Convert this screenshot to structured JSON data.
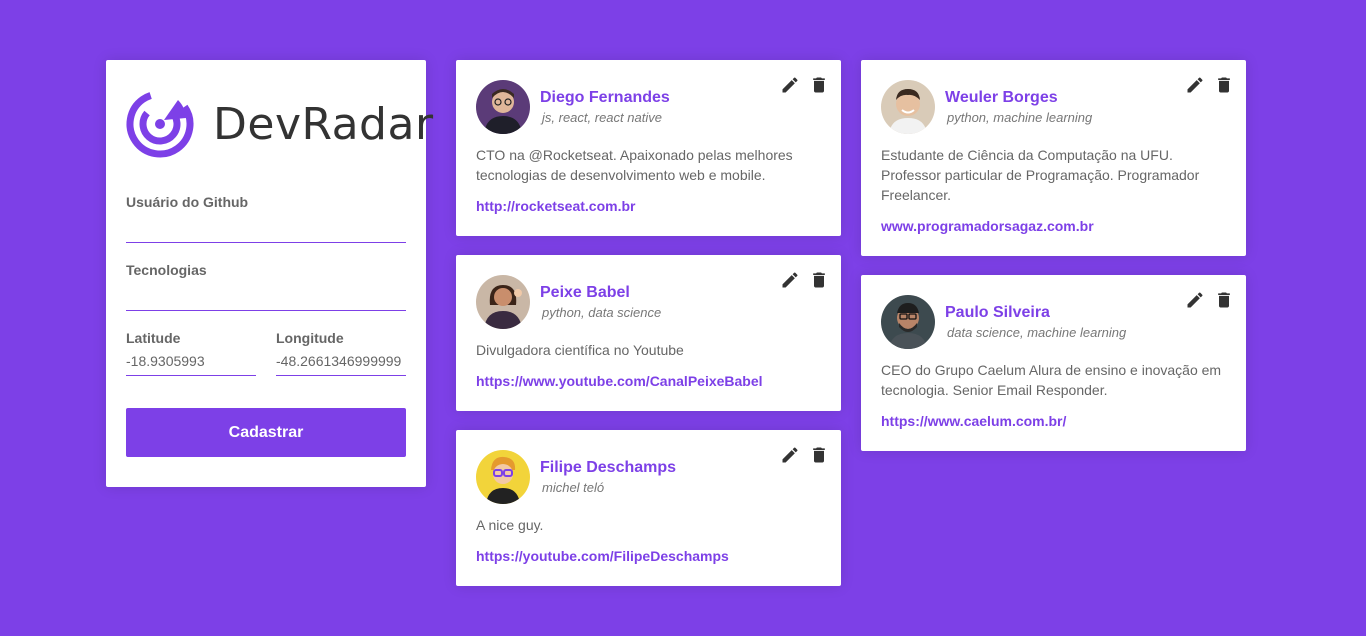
{
  "brand": {
    "name": "DevRadar",
    "color": "#7d40e7"
  },
  "form": {
    "github_label": "Usuário do Github",
    "github_value": "",
    "techs_label": "Tecnologias",
    "techs_value": "",
    "latitude_label": "Latitude",
    "latitude_value": "-18.9305993",
    "longitude_label": "Longitude",
    "longitude_value": "-48.2661346999999",
    "submit_label": "Cadastrar"
  },
  "devs": [
    {
      "name": "Diego Fernandes",
      "techs": "js, react, react native",
      "bio": "CTO na @Rocketseat. Apaixonado pelas melhores tecnologias de desenvolvimento web e mobile.",
      "link": "http://rocketseat.com.br",
      "avatar_bg": "#5b3b78"
    },
    {
      "name": "Peixe Babel",
      "techs": "python, data science",
      "bio": "Divulgadora científica no Youtube",
      "link": "https://www.youtube.com/CanalPeixeBabel",
      "avatar_bg": "#c9b7a6"
    },
    {
      "name": "Filipe Deschamps",
      "techs": "michel teló",
      "bio": "A nice guy.",
      "link": "https://youtube.com/FilipeDeschamps",
      "avatar_bg": "#f2d43a"
    },
    {
      "name": "Weuler Borges",
      "techs": "python, machine learning",
      "bio": "Estudante de Ciência da Computação na UFU. Professor particular de Programação. Programador Freelancer.",
      "link": "www.programadorsagaz.com.br",
      "avatar_bg": "#d9cbb8"
    },
    {
      "name": "Paulo Silveira",
      "techs": "data science, machine learning",
      "bio": "CEO do Grupo Caelum Alura de ensino e inovação em tecnologia. Senior Email Responder.",
      "link": "https://www.caelum.com.br/",
      "avatar_bg": "#3d4a4f"
    }
  ],
  "icons": {
    "edit": "pencil-icon",
    "delete": "trash-icon"
  }
}
